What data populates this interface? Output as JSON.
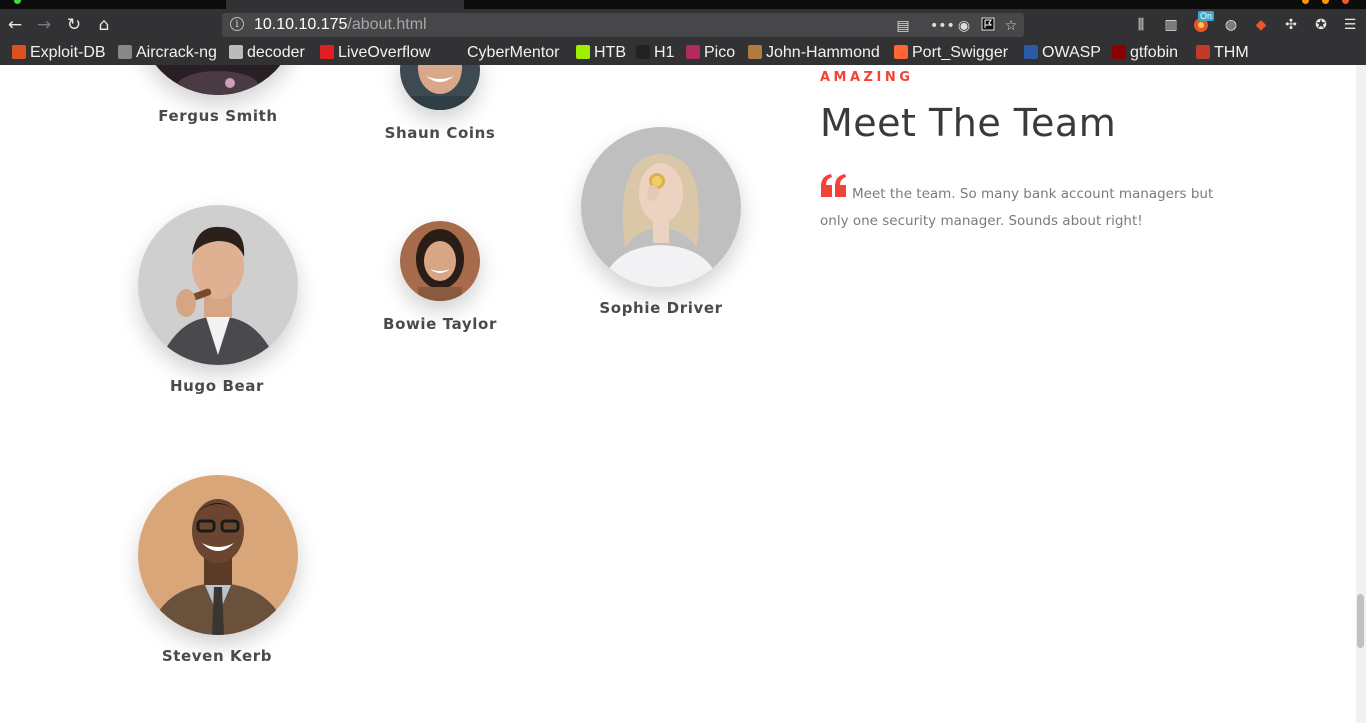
{
  "browser": {
    "url_host": "10.10.10.175",
    "url_path": "/about.html",
    "badge": "On"
  },
  "bookmarks": [
    {
      "label": "Exploit-DB",
      "color": "#d9531e"
    },
    {
      "label": "Aircrack-ng",
      "color": "#888888"
    },
    {
      "label": "decoder",
      "color": "#bbbbbb"
    },
    {
      "label": "LiveOverflow",
      "color": "#e02020"
    },
    {
      "label": "CyberMentor",
      "color": "#323234"
    },
    {
      "label": "HTB",
      "color": "#9fef00"
    },
    {
      "label": "H1",
      "color": "#222222"
    },
    {
      "label": "Pico",
      "color": "#b02a5a"
    },
    {
      "label": "John-Hammond",
      "color": "#b07a40"
    },
    {
      "label": "Port_Swigger",
      "color": "#ff6633"
    },
    {
      "label": "OWASP",
      "color": "#2a5aa8"
    },
    {
      "label": "gtfobin",
      "color": "#8b0000"
    },
    {
      "label": "THM",
      "color": "#c0392b"
    }
  ],
  "team": {
    "eyebrow": "AMAZING",
    "title": "Meet The Team",
    "description": "Meet the team. So many bank account managers but only one security manager. Sounds about right!",
    "members": [
      {
        "name": "Fergus Smith"
      },
      {
        "name": "Shaun Coins"
      },
      {
        "name": "Hugo Bear"
      },
      {
        "name": "Bowie Taylor"
      },
      {
        "name": "Sophie Driver"
      },
      {
        "name": "Steven Kerb"
      }
    ]
  },
  "colors": {
    "accent": "#f44336",
    "heading": "#3a3a3a",
    "body_text": "#7b7b7b",
    "chrome": "#323234"
  }
}
